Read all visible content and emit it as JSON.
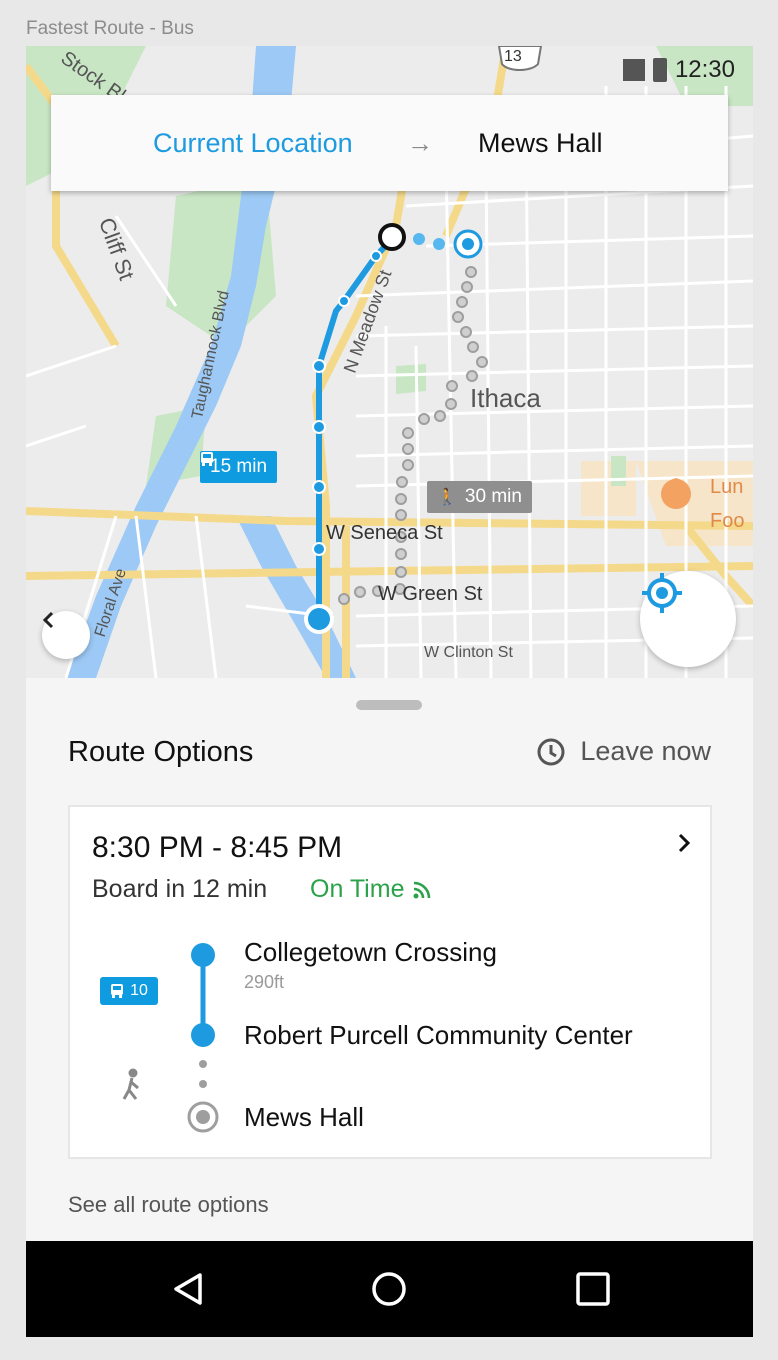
{
  "caption": "Fastest Route - Bus",
  "status": {
    "time": "12:30"
  },
  "route": {
    "from": "Current Location",
    "arrow": "→",
    "to": "Mews Hall"
  },
  "map": {
    "labels": {
      "city": "Ithaca",
      "cliff": "Cliff St",
      "taughannock": "Taughannock Blvd",
      "meadow": "N Meadow St",
      "seneca": "W Seneca St",
      "green": "W Green St",
      "clinton": "W Clinton St",
      "floral": "Floral Ave",
      "stock": "Stock Bl",
      "route13": "13",
      "lunch": "Lun",
      "food": "Foo"
    },
    "bus_time": "15 min",
    "walk_time": "30 min"
  },
  "sheet": {
    "title": "Route Options",
    "leave_label": "Leave now",
    "option": {
      "times": "8:30 PM - 8:45 PM",
      "board": "Board in 12 min",
      "status": "On Time",
      "bus_number": "10",
      "stops": [
        {
          "name": "Collegetown Crossing",
          "distance": "290ft"
        },
        {
          "name": "Robert Purcell Community Center"
        },
        {
          "name": "Mews Hall"
        }
      ]
    },
    "see_all": "See all route options"
  },
  "colors": {
    "accent": "#1e9be0",
    "bus": "#0e9be0",
    "on_time": "#2ba24a",
    "walk": "#8f8f8f"
  }
}
